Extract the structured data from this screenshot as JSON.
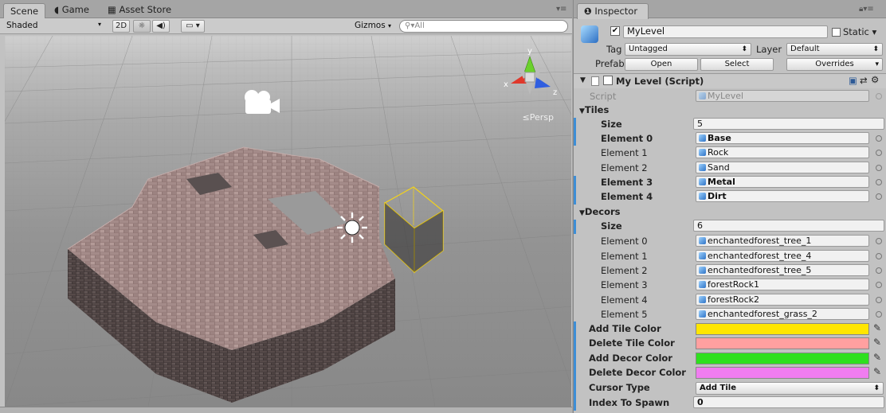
{
  "scene_tabs": [
    {
      "label": "Scene",
      "icon": "scene-icon"
    },
    {
      "label": "Game",
      "icon": "pacman-icon"
    },
    {
      "label": "Asset Store",
      "icon": "store-icon"
    }
  ],
  "scene_toolbar": {
    "shading_mode": "Shaded",
    "mode_2d": "2D",
    "gizmos": "Gizmos",
    "search_placeholder": "All"
  },
  "scene_view": {
    "persp_label": "Persp",
    "axis_x": "x",
    "axis_y": "y",
    "axis_z": "z"
  },
  "inspector": {
    "tab_label": "Inspector",
    "object_name": "MyLevel",
    "object_enabled": true,
    "static_label": "Static",
    "static_checked": false,
    "tag_label": "Tag",
    "tag_value": "Untagged",
    "layer_label": "Layer",
    "layer_value": "Default",
    "prefab_label": "Prefab",
    "prefab_open": "Open",
    "prefab_select": "Select",
    "prefab_overrides": "Overrides",
    "component_title": "My Level (Script)",
    "script_label": "Script",
    "script_value": "MyLevel",
    "tiles": {
      "header": "Tiles",
      "size_label": "Size",
      "size_value": "5",
      "elements": [
        {
          "label": "Element 0",
          "value": "Base",
          "bold": true
        },
        {
          "label": "Element 1",
          "value": "Rock",
          "bold": false
        },
        {
          "label": "Element 2",
          "value": "Sand",
          "bold": false
        },
        {
          "label": "Element 3",
          "value": "Metal",
          "bold": true
        },
        {
          "label": "Element 4",
          "value": "Dirt",
          "bold": true
        }
      ]
    },
    "decors": {
      "header": "Decors",
      "size_label": "Size",
      "size_value": "6",
      "elements": [
        {
          "label": "Element 0",
          "value": "enchantedforest_tree_1"
        },
        {
          "label": "Element 1",
          "value": "enchantedforest_tree_4"
        },
        {
          "label": "Element 2",
          "value": "enchantedforest_tree_5"
        },
        {
          "label": "Element 3",
          "value": "forestRock1"
        },
        {
          "label": "Element 4",
          "value": "forestRock2"
        },
        {
          "label": "Element 5",
          "value": "enchantedforest_grass_2"
        }
      ]
    },
    "colors": [
      {
        "label": "Add Tile Color",
        "color": "#ffe600"
      },
      {
        "label": "Delete Tile Color",
        "color": "#ffa0a0"
      },
      {
        "label": "Add Decor Color",
        "color": "#2ee01e"
      },
      {
        "label": "Delete Decor Color",
        "color": "#f07df0"
      }
    ],
    "cursor_type_label": "Cursor Type",
    "cursor_type_value": "Add Tile",
    "index_to_spawn_label": "Index To Spawn",
    "index_to_spawn_value": "0"
  },
  "accent_colors": {
    "selection_blue": "#3d8ed6",
    "selected_outline": "#f3d21b"
  }
}
